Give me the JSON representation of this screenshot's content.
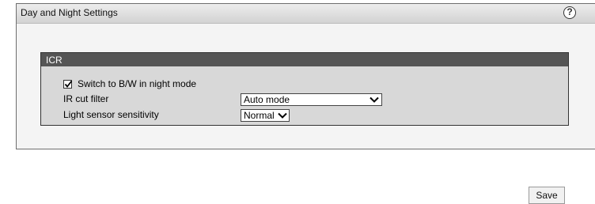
{
  "panel": {
    "title": "Day and Night Settings",
    "help": "?"
  },
  "icr": {
    "title": "ICR",
    "night_mode": {
      "label": "Switch to B/W in night mode",
      "checked": true
    },
    "ir_cut": {
      "label": "IR cut filter",
      "value": "Auto mode"
    },
    "light_sensor": {
      "label": "Light sensor sensitivity",
      "value": "Normal"
    }
  },
  "save_label": "Save"
}
